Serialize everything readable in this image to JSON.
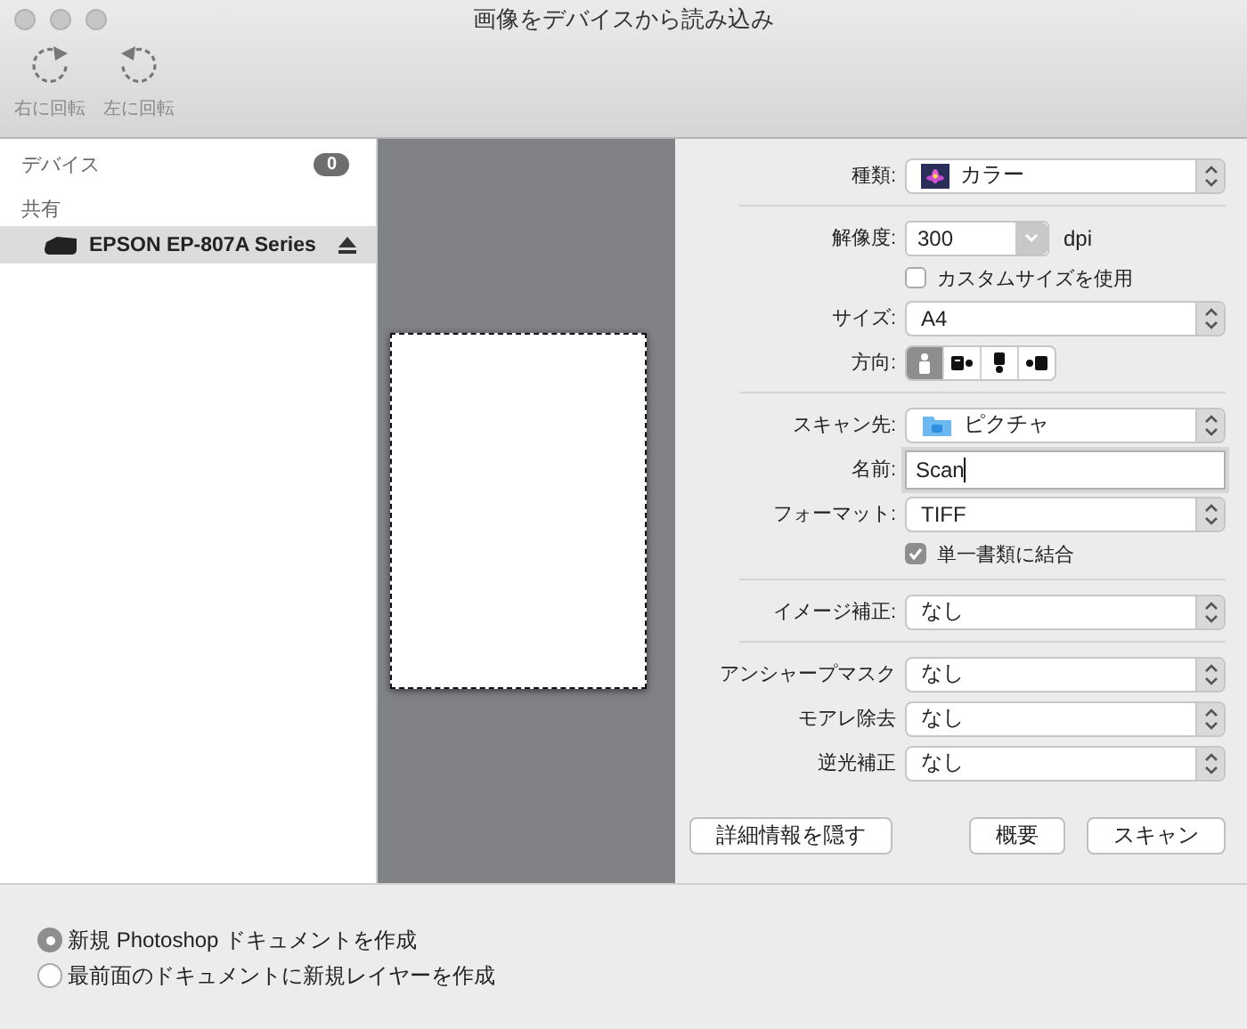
{
  "window": {
    "title": "画像をデバイスから読み込み"
  },
  "toolbar": [
    {
      "label": "右に回転",
      "kind": "rotate-right"
    },
    {
      "label": "左に回転",
      "kind": "rotate-left"
    }
  ],
  "sidebar": {
    "sections": [
      {
        "title": "デバイス",
        "count": "0"
      },
      {
        "title": "共有",
        "items": [
          {
            "label": "EPSON EP-807A Series",
            "selected": true
          }
        ]
      }
    ]
  },
  "settings": [
    {
      "kind": "colormode",
      "label": "種類:",
      "value": "カラー"
    },
    {
      "kind": "divider"
    },
    {
      "kind": "combo",
      "label": "解像度:",
      "value": "300",
      "unit": "dpi"
    },
    {
      "kind": "checkbox",
      "label": "カスタムサイズを使用",
      "checked": false
    },
    {
      "kind": "popup",
      "label": "サイズ:",
      "value": "A4"
    },
    {
      "kind": "segments",
      "label": "方向:",
      "segments": [
        {
          "kind": "portrait",
          "selected": true
        },
        {
          "kind": "left",
          "selected": false
        },
        {
          "kind": "upside",
          "selected": false
        },
        {
          "kind": "right",
          "selected": false
        }
      ]
    },
    {
      "kind": "divider"
    },
    {
      "kind": "destination",
      "label": "スキャン先:",
      "value": "ピクチャ"
    },
    {
      "kind": "text",
      "label": "名前:",
      "value": "Scan"
    },
    {
      "kind": "popup",
      "label": "フォーマット:",
      "value": "TIFF"
    },
    {
      "kind": "checkbox",
      "label": "単一書類に結合",
      "checked": true
    },
    {
      "kind": "divider"
    },
    {
      "kind": "popup",
      "label": "イメージ補正:",
      "value": "なし"
    },
    {
      "kind": "divider"
    },
    {
      "kind": "popup",
      "label": "アンシャープマスク",
      "value": "なし"
    },
    {
      "kind": "popup",
      "label": "モアレ除去",
      "value": "なし"
    },
    {
      "kind": "popup",
      "label": "逆光補正",
      "value": "なし"
    }
  ],
  "buttons": {
    "left": [
      "詳細情報を隠す"
    ],
    "right": [
      "概要",
      "スキャン"
    ]
  },
  "import_options": [
    {
      "label": "新規 Photoshop ドキュメントを作成",
      "selected": true
    },
    {
      "label": "最前面のドキュメントに新規レイヤーを作成",
      "selected": false
    }
  ]
}
